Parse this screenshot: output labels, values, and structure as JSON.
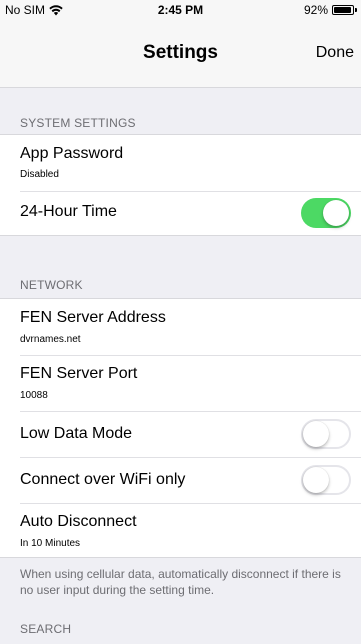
{
  "status_bar": {
    "carrier": "No SIM",
    "time": "2:45 PM",
    "battery": "92%",
    "battery_level": 0.92
  },
  "nav": {
    "title": "Settings",
    "done_label": "Done"
  },
  "system_settings": {
    "header": "SYSTEM SETTINGS",
    "app_password": {
      "label": "App Password",
      "value": "Disabled"
    },
    "hour_24": {
      "label": "24-Hour Time",
      "enabled": true
    }
  },
  "network": {
    "header": "NETWORK",
    "server_address": {
      "label": "FEN Server Address",
      "value": "dvrnames.net"
    },
    "server_port": {
      "label": "FEN Server Port",
      "value": "10088"
    },
    "low_data_mode": {
      "label": "Low Data Mode",
      "enabled": false
    },
    "wifi_only": {
      "label": "Connect over WiFi only",
      "enabled": false
    },
    "auto_disconnect": {
      "label": "Auto Disconnect",
      "value": "In 10 Minutes"
    },
    "footer": "When using cellular data, automatically disconnect if there is no user input during the setting time."
  },
  "search": {
    "header": "SEARCH"
  },
  "colors": {
    "toggle_on": "#4cd964",
    "background": "#efeff4",
    "section_text": "#6d6d72"
  }
}
